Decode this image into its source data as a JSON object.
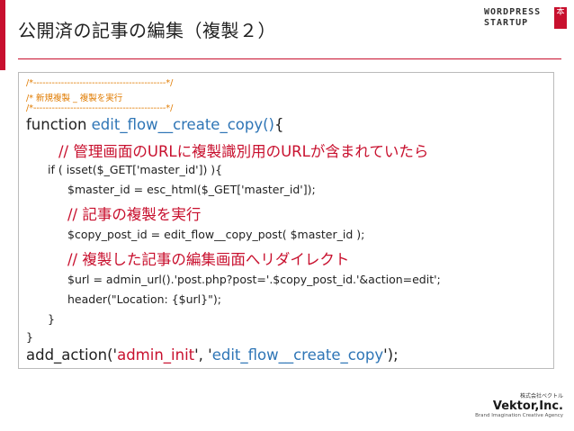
{
  "slide": {
    "title": "公開済の記事の編集（複製２）",
    "accent_color": "#c8102e"
  },
  "logo": {
    "line1": "WORDPRESS",
    "line2": "STARTUP",
    "badge": "本"
  },
  "code": {
    "comment1": "/*-------------------------------------------*/",
    "comment2": "/*  新規複製 _ 複製を実行",
    "comment3": "/*-------------------------------------------*/",
    "fn_keyword": "function ",
    "fn_name": "edit_flow__create_copy()",
    "fn_open": "{",
    "note1": "// 管理画面のURLに複製識別用のURLが含まれていたら",
    "if_line": "if ( isset($_GET['master_id']) ){",
    "master_line": "$master_id = esc_html($_GET['master_id']);",
    "note2": "// 記事の複製を実行",
    "copy_line": "$copy_post_id = edit_flow__copy_post( $master_id );",
    "note3": "// 複製した記事の編集画面へリダイレクト",
    "url_line": "$url = admin_url().'post.php?post='.$copy_post_id.'&action=edit';",
    "header_line": "header(\"Location: {$url}\");",
    "close_if": "}",
    "close_fn": "}",
    "action_prefix": "add_action('",
    "action_hook": "admin_init",
    "action_mid": "', '",
    "action_fn": "edit_flow__create_copy",
    "action_suffix": "');"
  },
  "company": {
    "small": "株式会社ベクトル",
    "name": "Vektor,Inc.",
    "tagline": "Brand Imagination Creative Agency"
  }
}
